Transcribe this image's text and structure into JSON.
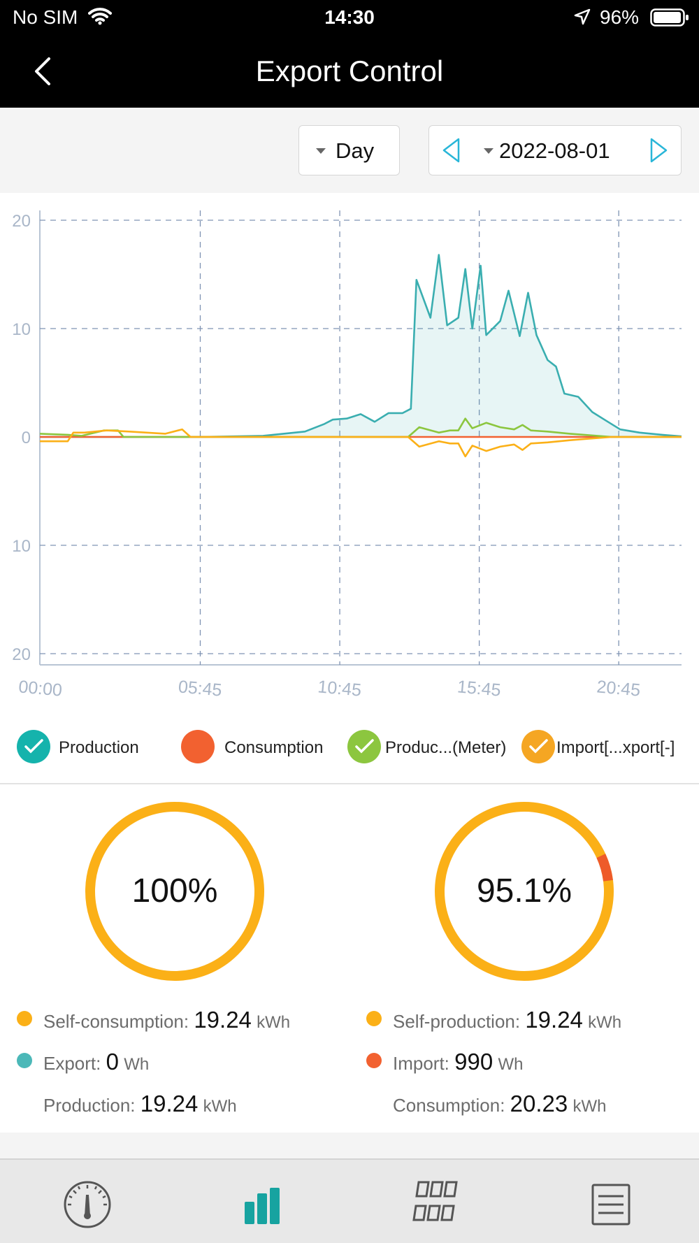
{
  "status_bar": {
    "carrier": "No SIM",
    "time": "14:30",
    "battery": "96%"
  },
  "header": {
    "title": "Export Control"
  },
  "controls": {
    "period": "Day",
    "date": "2022-08-01"
  },
  "chart_data": {
    "type": "line",
    "x_ticks": [
      "00:00",
      "05:45",
      "10:45",
      "15:45",
      "20:45"
    ],
    "y_ticks": [
      "20",
      "10",
      "0",
      "10",
      "20"
    ],
    "ylim": [
      -20,
      20
    ],
    "grid": true,
    "legend_position": "bottom",
    "series": [
      {
        "name": "Production",
        "color": "#3aaeb0",
        "fill": true,
        "x": [
          0,
          1.5,
          3,
          5.75,
          8,
          9.5,
          10.2,
          10.5,
          11,
          11.5,
          12,
          12.5,
          13,
          13.3,
          13.5,
          14,
          14.3,
          14.6,
          15,
          15.25,
          15.5,
          15.8,
          16,
          16.5,
          16.8,
          17.2,
          17.5,
          17.8,
          18.2,
          18.5,
          18.8,
          19.3,
          19.8,
          20.3,
          20.8,
          21.5,
          22.3,
          23
        ],
        "y": [
          0,
          0,
          0,
          0,
          0.1,
          0.5,
          1.2,
          1.6,
          1.7,
          2.1,
          1.4,
          2.2,
          2.2,
          2.6,
          14.5,
          11.0,
          16.8,
          10.3,
          11.0,
          15.5,
          10.0,
          15.8,
          9.4,
          10.7,
          13.5,
          9.3,
          13.3,
          9.4,
          7.1,
          6.5,
          4.0,
          3.7,
          2.3,
          1.5,
          0.7,
          0.4,
          0.2,
          0.05
        ]
      },
      {
        "name": "Consumption",
        "color": "#f26130",
        "x": [
          0,
          23
        ],
        "y": [
          0,
          0
        ]
      },
      {
        "name": "Produc...(Meter)",
        "color": "#8cc63f",
        "x": [
          0,
          1,
          1.5,
          2.3,
          2.8,
          3,
          13.2,
          13.6,
          14.3,
          14.7,
          15,
          15.25,
          15.5,
          16,
          16.5,
          17,
          17.3,
          17.6,
          18.2,
          19,
          19.5,
          20.5,
          23
        ],
        "y": [
          0.3,
          0.2,
          0.1,
          0.6,
          0.6,
          0,
          0,
          0.9,
          0.4,
          0.6,
          0.6,
          1.7,
          0.8,
          1.3,
          0.9,
          0.7,
          1.1,
          0.6,
          0.5,
          0.3,
          0.2,
          0,
          0
        ]
      },
      {
        "name": "Import[...xport[-]",
        "color": "#fbb017",
        "x": [
          0,
          1,
          1.2,
          1.6,
          2.4,
          3.2,
          4.5,
          5.1,
          5.4,
          5.75,
          13.2,
          13.6,
          14.3,
          14.7,
          15,
          15.25,
          15.5,
          16,
          16.5,
          17,
          17.3,
          17.6,
          18.2,
          19,
          19.5,
          20.5,
          23
        ],
        "y": [
          -0.4,
          -0.4,
          0.4,
          0.4,
          0.6,
          0.5,
          0.3,
          0.7,
          0,
          0,
          0,
          -0.9,
          -0.4,
          -0.6,
          -0.6,
          -1.8,
          -0.8,
          -1.3,
          -0.9,
          -0.7,
          -1.2,
          -0.6,
          -0.5,
          -0.3,
          -0.2,
          0,
          0
        ]
      }
    ]
  },
  "legend": [
    {
      "label": "Production",
      "color": "#15b3ac",
      "checked": true
    },
    {
      "label": "Consumption",
      "color": "#f26130",
      "checked": false
    },
    {
      "label": "Produc...(Meter)",
      "color": "#8cc63f",
      "checked": true
    },
    {
      "label": "Import[...xport[-]",
      "color": "#f5a623",
      "checked": true
    }
  ],
  "self_consumption_panel": {
    "percentage": "100%",
    "ring_fraction": 1.0,
    "ring_color": "#fbb017",
    "rows": [
      {
        "label": "Self-consumption: ",
        "value": "19.24",
        "unit": "kWh",
        "dot": "#fbb017"
      },
      {
        "label": "Export: ",
        "value": "0",
        "unit": "Wh",
        "dot": "#4bb8b8"
      },
      {
        "label": "Production: ",
        "value": "19.24",
        "unit": "kWh",
        "dot": ""
      }
    ]
  },
  "self_production_panel": {
    "percentage": "95.1%",
    "ring_fraction": 0.951,
    "ring_color": "#fbb017",
    "ring_remainder_color": "#ee5b2a",
    "rows": [
      {
        "label": "Self-production: ",
        "value": "19.24",
        "unit": "kWh",
        "dot": "#fbb017"
      },
      {
        "label": "Import: ",
        "value": "990",
        "unit": "Wh",
        "dot": "#f26130"
      },
      {
        "label": "Consumption: ",
        "value": "20.23",
        "unit": "kWh",
        "dot": ""
      }
    ]
  },
  "tab_bar": {
    "icons": [
      "gauge-icon",
      "bar-chart-icon",
      "grid-icon",
      "list-icon"
    ],
    "active": 1,
    "active_color": "#17a3a0"
  }
}
